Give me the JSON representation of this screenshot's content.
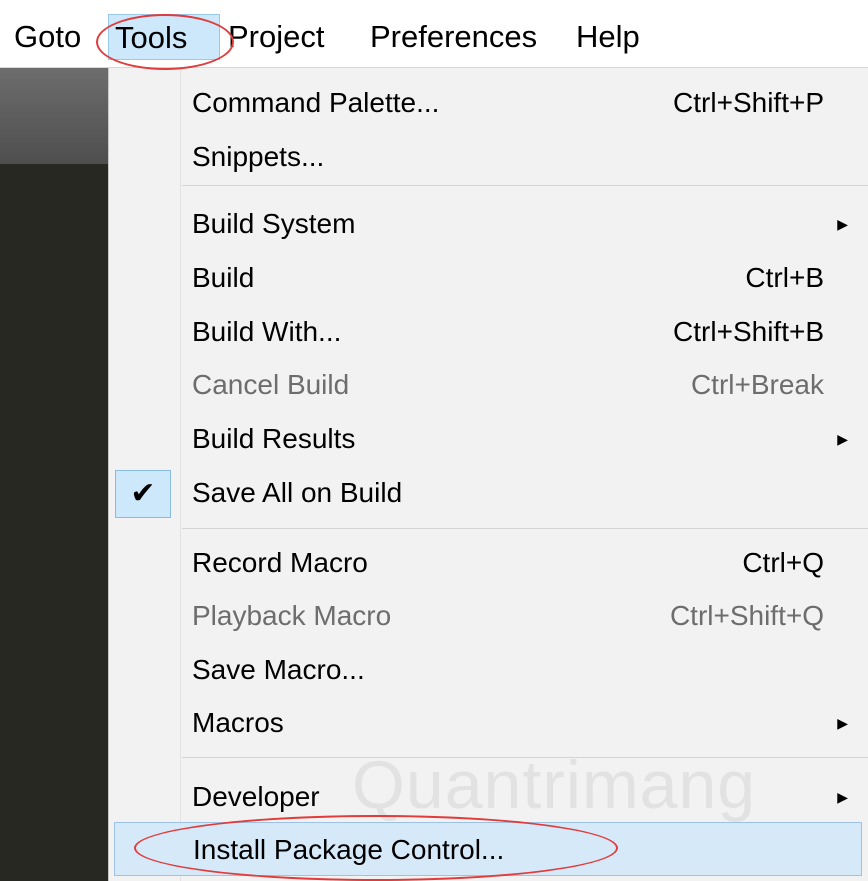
{
  "menubar": {
    "items": [
      {
        "label": "Goto"
      },
      {
        "label": "Tools"
      },
      {
        "label": "Project"
      },
      {
        "label": "Preferences"
      },
      {
        "label": "Help"
      }
    ],
    "selected": "Tools"
  },
  "tools_menu": {
    "items": [
      {
        "label": "Command Palette...",
        "shortcut": "Ctrl+Shift+P"
      },
      {
        "label": "Snippets...",
        "shortcut": ""
      },
      {
        "label": "Build System",
        "shortcut": "",
        "submenu": true
      },
      {
        "label": "Build",
        "shortcut": "Ctrl+B"
      },
      {
        "label": "Build With...",
        "shortcut": "Ctrl+Shift+B"
      },
      {
        "label": "Cancel Build",
        "shortcut": "Ctrl+Break",
        "disabled": true
      },
      {
        "label": "Build Results",
        "shortcut": "",
        "submenu": true
      },
      {
        "label": "Save All on Build",
        "shortcut": "",
        "checked": true
      },
      {
        "label": "Record Macro",
        "shortcut": "Ctrl+Q"
      },
      {
        "label": "Playback Macro",
        "shortcut": "Ctrl+Shift+Q",
        "disabled": true
      },
      {
        "label": "Save Macro...",
        "shortcut": ""
      },
      {
        "label": "Macros",
        "shortcut": "",
        "submenu": true
      },
      {
        "label": "Developer",
        "shortcut": "",
        "submenu": true
      },
      {
        "label": "Install Package Control...",
        "shortcut": "",
        "hovered": true
      }
    ],
    "check_glyph": "✔",
    "submenu_glyph": "▶"
  },
  "watermark": {
    "text": "Quantrimang"
  },
  "colors": {
    "highlight_ellipse": "#e03c3c",
    "selection_fill": "#cde8fb",
    "menu_background": "#f2f2f2",
    "editor_background": "#272822"
  }
}
